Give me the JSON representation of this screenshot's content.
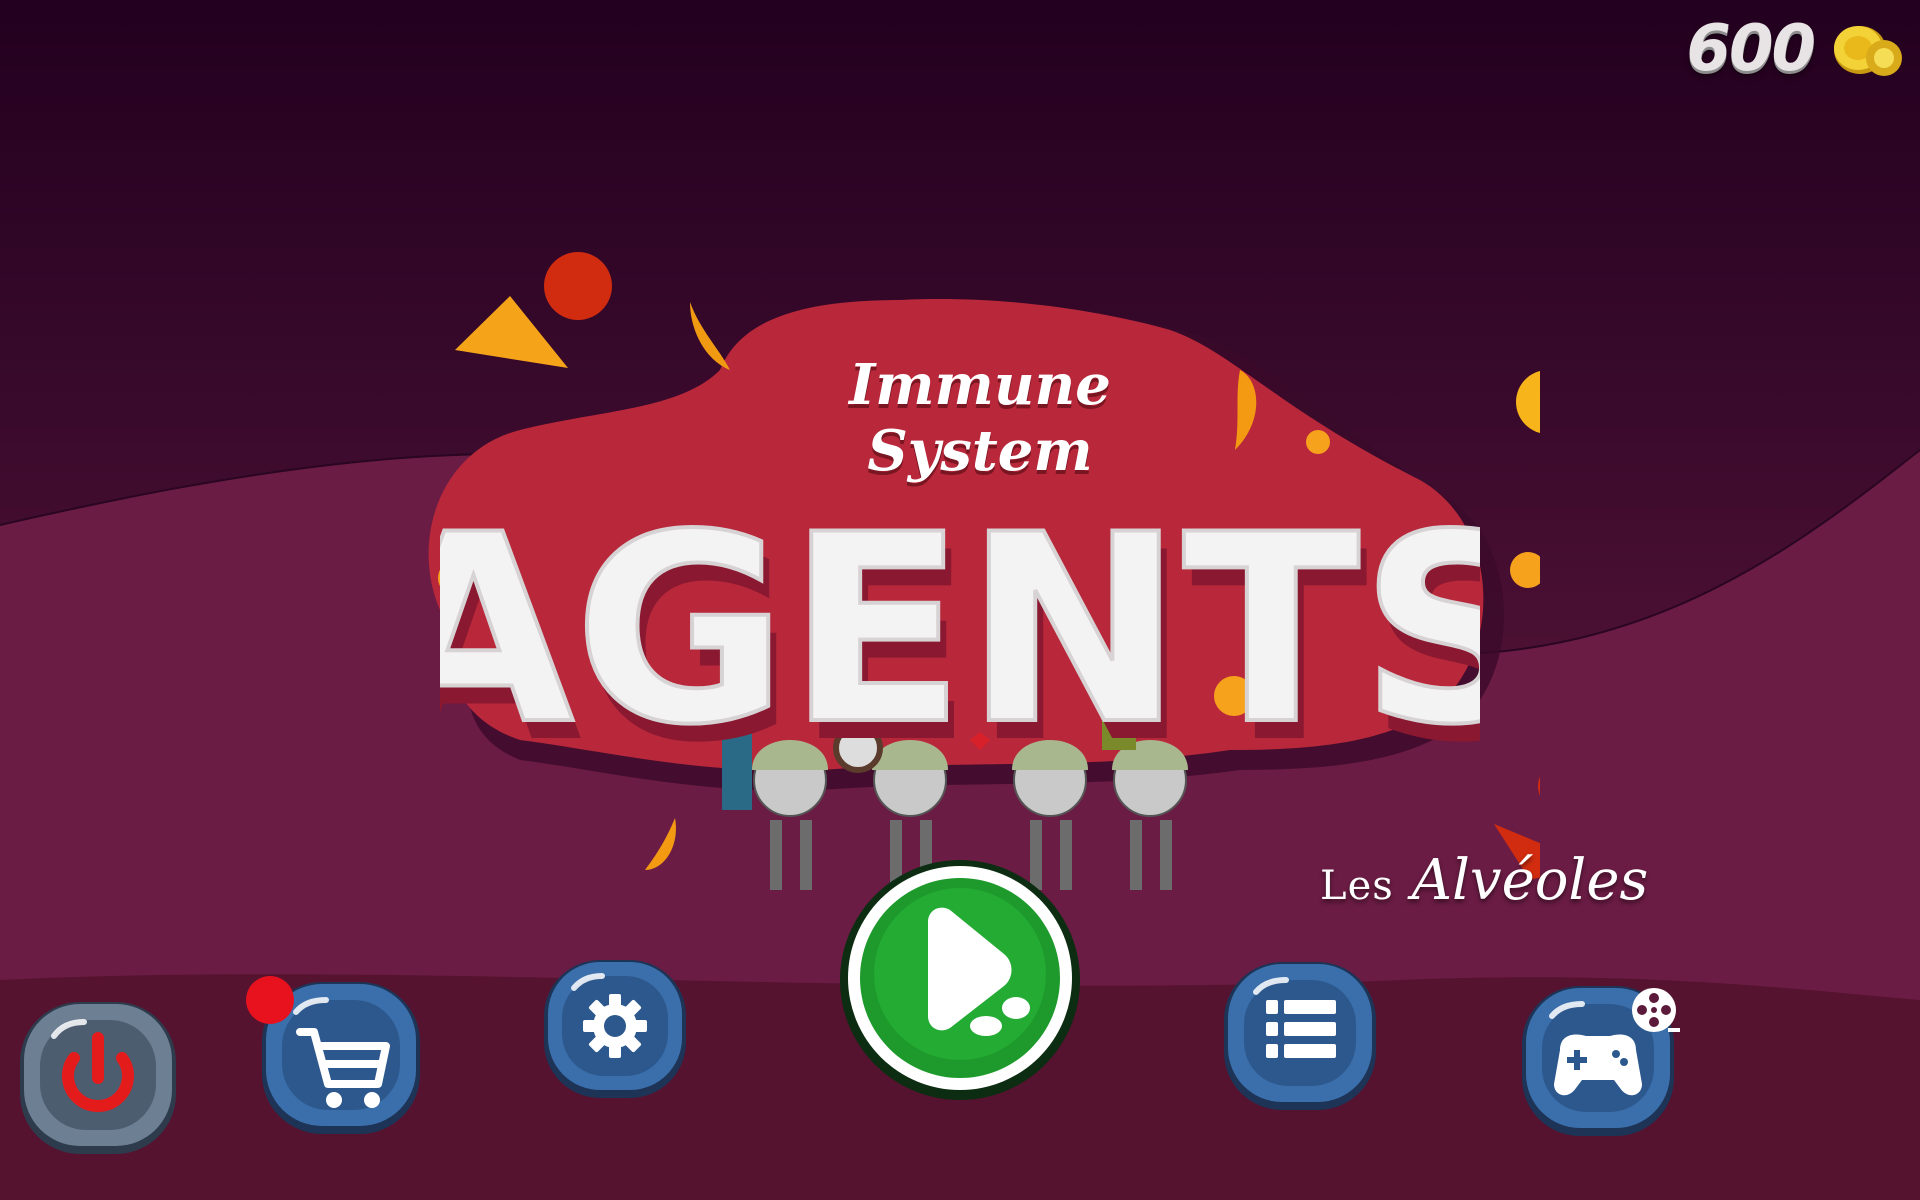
{
  "game": {
    "title_small": "Immune System",
    "title_large": "AGENTS",
    "brand_prefix": "Les",
    "brand_name": "Alvéoles"
  },
  "hud": {
    "coins": "600",
    "coin_icon": "gold-coins-icon"
  },
  "menu": {
    "power": "power-icon",
    "shop": "shopping-cart-icon",
    "settings": "gear-icon",
    "play": "play-icon",
    "levels": "list-icon",
    "games": "gamepad-icon",
    "video": "film-reel-icon",
    "shop_badge_color": "#e8121f"
  },
  "colors": {
    "background_dark": "#23001f",
    "background_wave": "#6e1d45",
    "logo_red": "#b8283a",
    "button_blue": "#2f5f99",
    "play_green": "#1e9a2c",
    "confetti_orange": "#f7a21c"
  }
}
